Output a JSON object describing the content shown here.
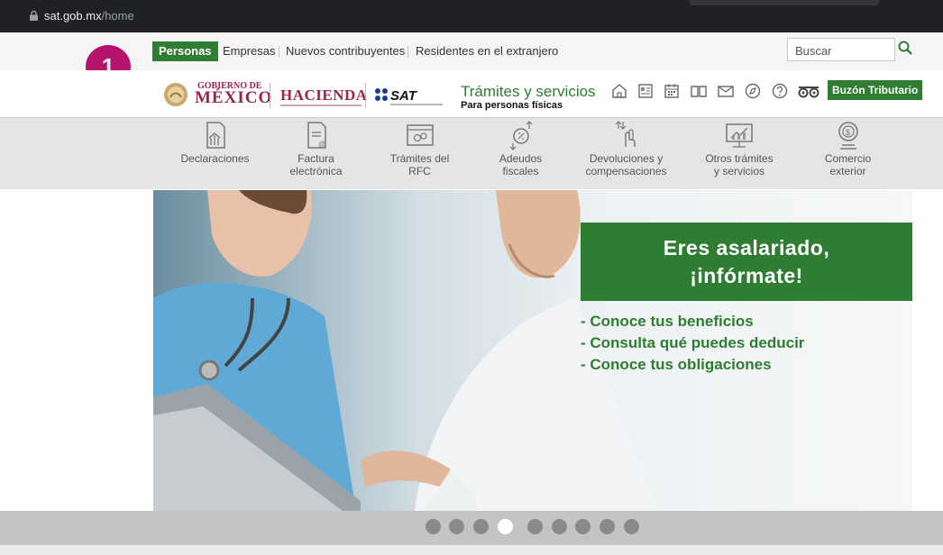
{
  "browser": {
    "url_domain": "sat.gob.mx",
    "url_path": "/home"
  },
  "topnav": {
    "tabs": [
      {
        "label": "Personas"
      },
      {
        "label": "Empresas"
      },
      {
        "label": "Nuevos contribuyentes"
      },
      {
        "label": "Residentes en el extranjero"
      }
    ],
    "search_placeholder": "Buscar"
  },
  "annotation": {
    "number": "1",
    "color": "#b5136c"
  },
  "header": {
    "gob_line1": "GOBIERNO DE",
    "gob_line2": "MÉXICO",
    "hacienda": "HACIENDA",
    "sat": "SAT",
    "title": "Trámites y servicios",
    "subtitle": "Para personas físicas",
    "icons": [
      "home-icon",
      "news-icon",
      "calendar-icon",
      "book-icon",
      "mail-icon",
      "compass-icon",
      "help-icon",
      "accessibility-icon"
    ],
    "buzon_label": "Buzón Tributario"
  },
  "categories": [
    {
      "line1": "Declaraciones",
      "line2": "",
      "icon": "declaraciones-icon"
    },
    {
      "line1": "Factura",
      "line2": "electrónica",
      "icon": "factura-icon"
    },
    {
      "line1": "Trámites del",
      "line2": "RFC",
      "icon": "rfc-icon"
    },
    {
      "line1": "Adeudos",
      "line2": "fiscales",
      "icon": "adeudos-icon"
    },
    {
      "line1": "Devoluciones y",
      "line2": "compensaciones",
      "icon": "devoluciones-icon"
    },
    {
      "line1": "Otros trámites",
      "line2": "y servicios",
      "icon": "otros-icon"
    },
    {
      "line1": "Comercio",
      "line2": "exterior",
      "icon": "comercio-icon"
    }
  ],
  "banner": {
    "headline_line1": "Eres asalariado,",
    "headline_line2": "¡infórmate!",
    "bullets": [
      "- Conoce tus beneficios",
      "- Consulta qué puedes deducir",
      "- Conoce tus obligaciones"
    ]
  },
  "carousel": {
    "total": 9,
    "active_index": 3
  },
  "colors": {
    "brand_green": "#2f7d32",
    "gob_maroon": "#9d2449"
  }
}
